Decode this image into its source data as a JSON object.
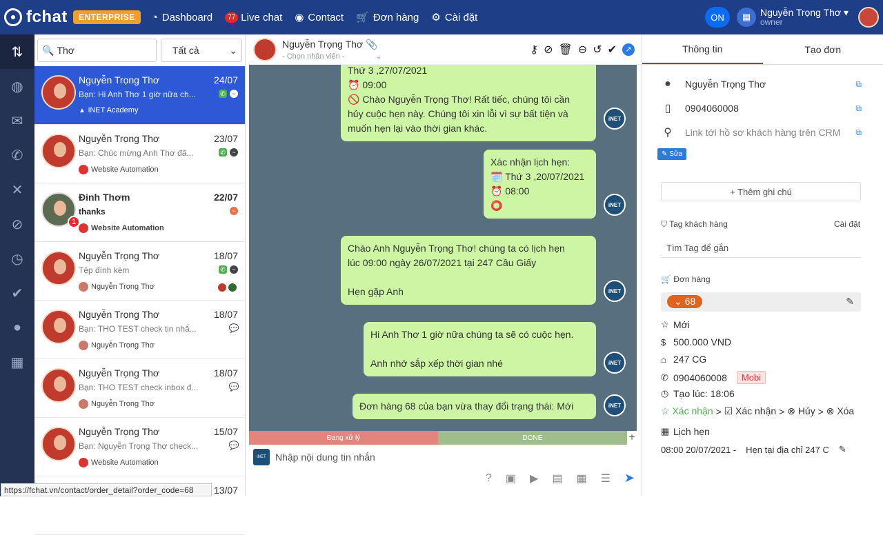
{
  "brand": {
    "name": "fchat",
    "badge": "ENTERPRISE"
  },
  "nav": {
    "dashboard": "Dashboard",
    "livechat": "Live chat",
    "livechat_count": "77",
    "contact": "Contact",
    "orders": "Đơn hàng",
    "settings": "Cài đặt"
  },
  "user": {
    "toggle": "ON",
    "name": "Nguyễn Trọng Thơ",
    "role": "owner"
  },
  "search": {
    "value": "Thơ",
    "filter": "Tất cả"
  },
  "conversations": [
    {
      "name": "Nguyễn Trọng Thơ",
      "date": "24/07",
      "preview": "Bạn: Hi Anh Thơ 1 giờ nữa ch...",
      "source": "iNET Academy"
    },
    {
      "name": "Nguyễn Trọng Thơ",
      "date": "23/07",
      "preview": "Bạn: Chúc mừng Anh Thơ đã...",
      "source": "Website Automation"
    },
    {
      "name": "Đinh Thơm",
      "date": "22/07",
      "preview": "thanks",
      "source": "Website Automation",
      "unread": "1"
    },
    {
      "name": "Nguyễn Trọng Thơ",
      "date": "18/07",
      "preview": "Tệp đính kèm",
      "source": "Nguyễn Trọng Thơ"
    },
    {
      "name": "Nguyễn Trọng Thơ",
      "date": "18/07",
      "preview": "Bạn: THO TEST check tin nhắ...",
      "source": "Nguyễn Trọng Thơ"
    },
    {
      "name": "Nguyễn Trọng Thơ",
      "date": "18/07",
      "preview": "Bạn: THO TEST check inbox đ...",
      "source": "Nguyễn Trọng Thơ"
    },
    {
      "name": "Nguyễn Trọng Thơ",
      "date": "15/07",
      "preview": "Bạn: Nguyễn Trọng Thơ check...",
      "source": "Website Automation"
    },
    {
      "name": "",
      "date": "13/07",
      "preview": "",
      "source": ""
    }
  ],
  "chat": {
    "contact_name": "Nguyễn Trọng Thơ",
    "assignee_placeholder": "- Chọn nhân viên -",
    "messages": [
      {
        "lines": [
          "Thứ 3 ,27/07/2021",
          "⏰ 09:00",
          "🚫 Chào Nguyễn Trọng Thơ! Rất tiếc, chúng tôi cần",
          "hủy cuộc hẹn này. Chúng tôi xin lỗi vì sự bất tiện và",
          "muốn hẹn lại vào thời gian khác."
        ]
      },
      {
        "lines": [
          "Xác nhận lịch hẹn:",
          "🗓️ Thứ 3 ,20/07/2021",
          "⏰ 08:00",
          "⭕"
        ]
      },
      {
        "lines": [
          "Chào Anh Nguyễn Trọng Thơ! chúng ta có lịch hẹn",
          "lúc 09:00 ngày 26/07/2021 tại 247 Cầu Giấy",
          "",
          "Hẹn gặp Anh"
        ]
      },
      {
        "lines": [
          "Hi Anh Thơ 1 giờ nữa chúng ta sẽ có cuộc hẹn.",
          "",
          "Anh nhớ sắp xếp thời gian nhé"
        ]
      },
      {
        "lines": [
          "Đơn hàng 68 của bạn vừa thay đổi trạng thái: Mới"
        ]
      }
    ],
    "bot_label": "iNET",
    "status_processing": "Đang xử lý",
    "status_done": "DONE",
    "input_placeholder": "Nhập nội dung tin nhắn"
  },
  "info": {
    "tab_info": "Thông tin",
    "tab_order": "Tạo đơn",
    "name": "Nguyễn Trọng Thơ",
    "phone": "0904060008",
    "crm_link": "Link tới hồ sơ khách hàng trên CRM",
    "edit": "Sửa",
    "add_note": "+ Thêm ghi chú",
    "tag_label": "Tag khách hàng",
    "tag_settings": "Cài đặt",
    "tag_search": "Tìm Tag để gắn",
    "order_label": "Đơn hàng",
    "order_number": "68",
    "order_status": "Mới",
    "order_amount": "500.000 VND",
    "order_address": "247 CG",
    "order_phone": "0904060008",
    "phone_type": "Mobi",
    "created": "Tạo lúc: 18:06",
    "steps": {
      "s1": "Xác nhận",
      "s2": "Xác nhận",
      "s3": "Hủy",
      "s4": "Xóa"
    },
    "appointment_label": "Lịch hẹn",
    "appointment_time": "08:00 20/07/2021 -",
    "appointment_place": "Hẹn tại địa chỉ 247 C"
  },
  "statusbar_url": "https://fchat.vn/contact/order_detail?order_code=68"
}
